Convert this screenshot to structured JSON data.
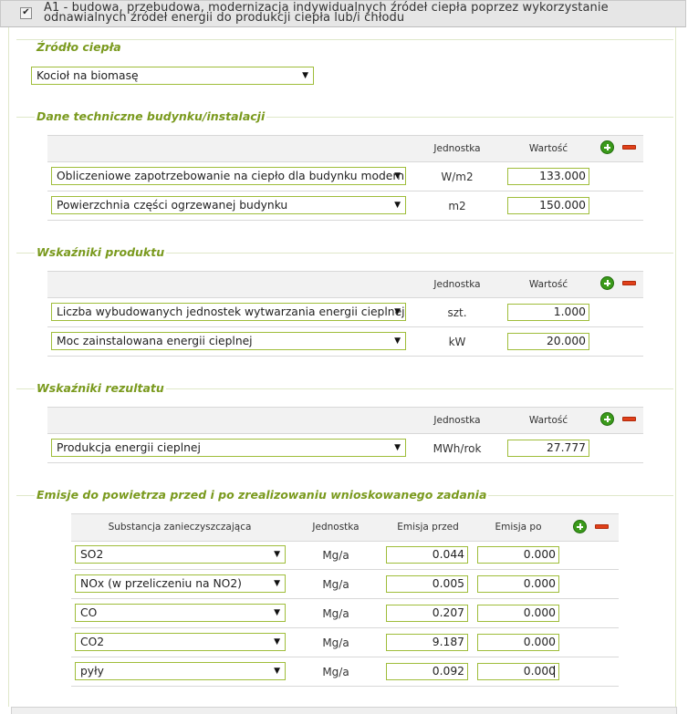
{
  "header": {
    "checkbox_mark": "✔",
    "title_line1": "A1 - budowa, przebudowa, modernizacja indywidualnych źródeł ciepła poprzez wykorzystanie",
    "title_line2": "odnawialnych źródeł energii do produkcji ciepła lub/i chłodu"
  },
  "heat_source": {
    "legend": "Źródło ciepła",
    "selected": "Kocioł na biomasę"
  },
  "technical": {
    "legend": "Dane techniczne budynku/instalacji",
    "col_unit": "Jednostka",
    "col_value": "Wartość",
    "rows": [
      {
        "name": "Obliczeniowe zapotrzebowanie na ciepło dla budynku modernizo",
        "unit": "W/m2",
        "value": "133.000"
      },
      {
        "name": "Powierzchnia części ogrzewanej budynku",
        "unit": "m2",
        "value": "150.000"
      }
    ]
  },
  "product": {
    "legend": "Wskaźniki produktu",
    "col_unit": "Jednostka",
    "col_value": "Wartość",
    "rows": [
      {
        "name": "Liczba wybudowanych jednostek wytwarzania energii cieplnej",
        "unit": "szt.",
        "value": "1.000"
      },
      {
        "name": "Moc zainstalowana energii cieplnej",
        "unit": "kW",
        "value": "20.000"
      }
    ]
  },
  "result": {
    "legend": "Wskaźniki rezultatu",
    "col_unit": "Jednostka",
    "col_value": "Wartość",
    "rows": [
      {
        "name": "Produkcja energii cieplnej",
        "unit": "MWh/rok",
        "value": "27.777"
      }
    ]
  },
  "emissions": {
    "legend": "Emisje do powietrza przed i po zrealizowaniu wnioskowanego zadania",
    "col_substance": "Substancja zanieczyszczająca",
    "col_unit": "Jednostka",
    "col_before": "Emisja przed",
    "col_after": "Emisja po",
    "rows": [
      {
        "substance": "SO2",
        "unit": "Mg/a",
        "before": "0.044",
        "after": "0.000"
      },
      {
        "substance": "NOx (w przeliczeniu na NO2)",
        "unit": "Mg/a",
        "before": "0.005",
        "after": "0.000"
      },
      {
        "substance": "CO",
        "unit": "Mg/a",
        "before": "0.207",
        "after": "0.000"
      },
      {
        "substance": "CO2",
        "unit": "Mg/a",
        "before": "9.187",
        "after": "0.000"
      },
      {
        "substance": "pyły",
        "unit": "Mg/a",
        "before": "0.092",
        "after": "0.000"
      }
    ]
  },
  "icons": {
    "select_arrow": "▼",
    "add": "plus-icon",
    "remove": "minus-icon"
  },
  "colors": {
    "accent_green": "#7a9a1e",
    "field_border": "#9fbd3a",
    "add_green": "#3a9a1a",
    "remove_red": "#e0401a"
  }
}
